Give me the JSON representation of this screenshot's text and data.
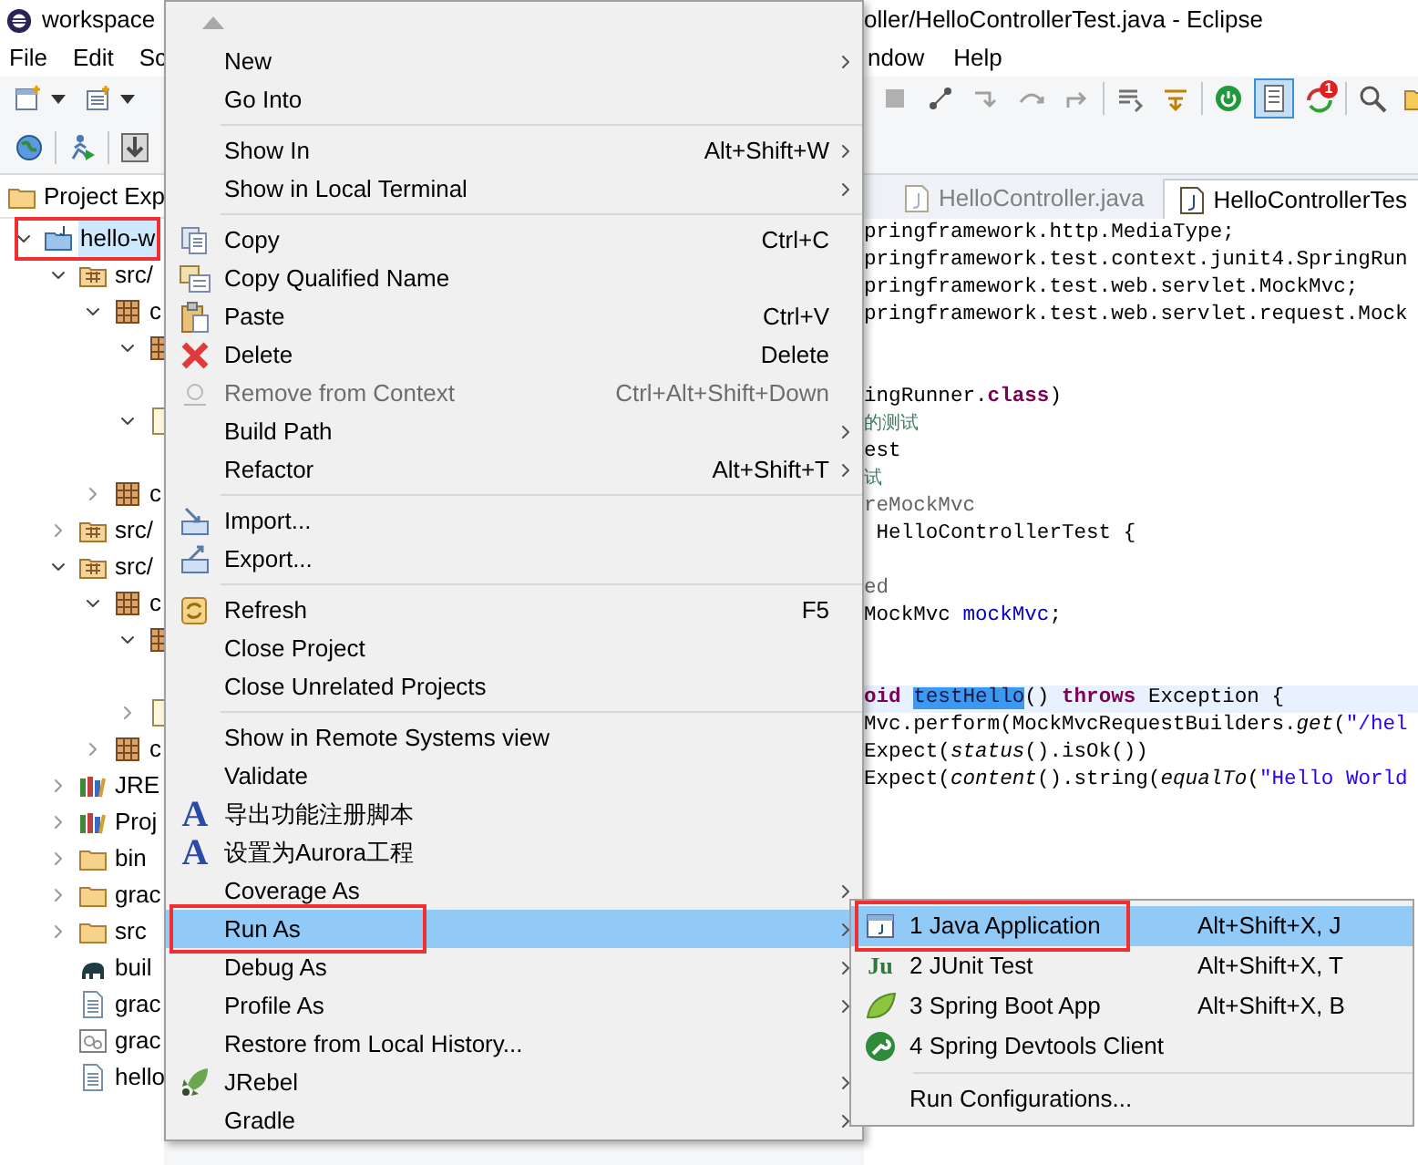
{
  "window": {
    "title_left": "workspace",
    "title_right": "oller/HelloControllerTest.java - Eclipse"
  },
  "menubar_left": [
    "File",
    "Edit",
    "Sc"
  ],
  "menubar_right": [
    "ndow",
    "Help"
  ],
  "toolbar_left": [
    {
      "kind": "new-window",
      "dropdown": true
    },
    {
      "kind": "new-file",
      "dropdown": true
    }
  ],
  "toolbar_right": [
    {
      "kind": "stop",
      "pressed": false
    },
    {
      "kind": "connect",
      "pressed": false
    },
    {
      "kind": "step-into",
      "pressed": false
    },
    {
      "kind": "step-over",
      "pressed": false
    },
    {
      "kind": "step-return",
      "pressed": false
    },
    {
      "kind": "separator"
    },
    {
      "kind": "filters",
      "pressed": false
    },
    {
      "kind": "drop-frame",
      "pressed": false
    },
    {
      "kind": "separator"
    },
    {
      "kind": "power",
      "pressed": false
    },
    {
      "kind": "toggle",
      "pressed": true
    },
    {
      "kind": "sync",
      "badge": "1",
      "pressed": false
    },
    {
      "kind": "separator"
    },
    {
      "kind": "search",
      "pressed": false
    },
    {
      "kind": "folder",
      "pressed": false
    }
  ],
  "toolbar_second": [
    {
      "kind": "globe"
    },
    {
      "kind": "separator"
    },
    {
      "kind": "run-person"
    },
    {
      "kind": "separator"
    },
    {
      "kind": "download"
    }
  ],
  "explorer": {
    "tab": "Project Exp",
    "tree": [
      {
        "label": "hello-w",
        "kind": "project",
        "expanded": true,
        "highlighted": true,
        "children": [
          {
            "label": "src/",
            "kind": "source-folder",
            "expanded": true,
            "children": [
              {
                "label": "c",
                "kind": "package",
                "expanded": true,
                "children": [
                  {
                    "kind": "package",
                    "expanded": true
                  },
                  {
                    "kind": "file",
                    "expanded": true
                  }
                ]
              },
              {
                "label": "c",
                "kind": "package",
                "expanded": false
              }
            ]
          },
          {
            "label": "src/",
            "kind": "source-folder",
            "expanded": false
          },
          {
            "label": "src/",
            "kind": "source-folder",
            "expanded": true,
            "children": [
              {
                "label": "c",
                "kind": "package",
                "expanded": true,
                "children": [
                  {
                    "kind": "package",
                    "expanded": true
                  },
                  {
                    "kind": "file",
                    "expanded": false
                  }
                ]
              },
              {
                "label": "c",
                "kind": "package",
                "expanded": false
              }
            ]
          },
          {
            "label": "JRE",
            "kind": "library",
            "expanded": false
          },
          {
            "label": "Proj",
            "kind": "library",
            "expanded": false
          },
          {
            "label": "bin",
            "kind": "folder",
            "expanded": false
          },
          {
            "label": "grac",
            "kind": "folder",
            "expanded": false
          },
          {
            "label": "src",
            "kind": "folder",
            "expanded": false
          },
          {
            "label": "buil",
            "kind": "gradle-file"
          },
          {
            "label": "grac",
            "kind": "text-file"
          },
          {
            "label": "grac",
            "kind": "settings-file"
          },
          {
            "label": "hello",
            "kind": "text-file"
          }
        ]
      }
    ]
  },
  "editor": {
    "tabs": [
      {
        "label": "HelloController.java",
        "selected": false
      },
      {
        "label": "HelloControllerTes",
        "selected": true
      }
    ],
    "code_lines": [
      {
        "kind": "code",
        "current": false,
        "tokens": [
          {
            "text": "pringframework.http.MediaType;",
            "kind": "plain"
          }
        ]
      },
      {
        "kind": "code",
        "current": false,
        "tokens": [
          {
            "text": "pringframework.test.context.junit4.SpringRun",
            "kind": "plain"
          }
        ]
      },
      {
        "kind": "code",
        "current": false,
        "tokens": [
          {
            "text": "pringframework.test.web.servlet.MockMvc;",
            "kind": "plain"
          }
        ]
      },
      {
        "kind": "code",
        "current": false,
        "tokens": [
          {
            "text": "pringframework.test.web.servlet.request.Mock",
            "kind": "plain"
          }
        ]
      },
      {
        "kind": "blank"
      },
      {
        "kind": "blank"
      },
      {
        "kind": "code",
        "current": false,
        "tokens": [
          {
            "text": "ingRunner.",
            "kind": "plain"
          },
          {
            "text": "class",
            "kind": "keyword"
          },
          {
            "text": ")",
            "kind": "plain"
          }
        ]
      },
      {
        "kind": "code",
        "current": false,
        "tokens": [
          {
            "text": "的测试",
            "kind": "comment"
          }
        ]
      },
      {
        "kind": "code",
        "current": false,
        "tokens": [
          {
            "text": "est",
            "kind": "plain"
          }
        ]
      },
      {
        "kind": "code",
        "current": false,
        "tokens": [
          {
            "text": "试",
            "kind": "comment"
          }
        ]
      },
      {
        "kind": "code",
        "current": false,
        "tokens": [
          {
            "text": "reMockMvc",
            "kind": "annotation"
          }
        ]
      },
      {
        "kind": "code",
        "current": false,
        "tokens": [
          {
            "text": " HelloControllerTest {",
            "kind": "plain"
          }
        ]
      },
      {
        "kind": "blank"
      },
      {
        "kind": "code",
        "current": false,
        "tokens": [
          {
            "text": "ed",
            "kind": "annotation"
          }
        ]
      },
      {
        "kind": "code",
        "current": false,
        "tokens": [
          {
            "text": "MockMvc ",
            "kind": "plain"
          },
          {
            "text": "mockMvc",
            "kind": "field"
          },
          {
            "text": ";",
            "kind": "plain"
          }
        ]
      },
      {
        "kind": "blank"
      },
      {
        "kind": "blank"
      },
      {
        "kind": "code",
        "current": true,
        "tokens": [
          {
            "text": "oid ",
            "kind": "keyword"
          },
          {
            "text": "testHello",
            "kind": "selected"
          },
          {
            "text": "() ",
            "kind": "plain"
          },
          {
            "text": "throws",
            "kind": "keyword"
          },
          {
            "text": " Exception {",
            "kind": "plain"
          }
        ]
      },
      {
        "kind": "code",
        "current": false,
        "tokens": [
          {
            "text": "Mvc.perform(MockMvcRequestBuilders.",
            "kind": "plain"
          },
          {
            "text": "get",
            "kind": "italic"
          },
          {
            "text": "(",
            "kind": "plain"
          },
          {
            "text": "\"/hel",
            "kind": "string"
          }
        ]
      },
      {
        "kind": "code",
        "current": false,
        "tokens": [
          {
            "text": "Expect(",
            "kind": "plain"
          },
          {
            "text": "status",
            "kind": "italic"
          },
          {
            "text": "().isOk())",
            "kind": "plain"
          }
        ]
      },
      {
        "kind": "code",
        "current": false,
        "tokens": [
          {
            "text": "Expect(",
            "kind": "plain"
          },
          {
            "text": "content",
            "kind": "italic"
          },
          {
            "text": "().string(",
            "kind": "plain"
          },
          {
            "text": "equalTo",
            "kind": "italic"
          },
          {
            "text": "(",
            "kind": "plain"
          },
          {
            "text": "\"Hello World",
            "kind": "string"
          }
        ]
      }
    ]
  },
  "context_menu": {
    "groups": [
      [
        {
          "label": "New",
          "kind": "plain",
          "submenu": true,
          "disabled": false,
          "selected": false,
          "highlighted": false
        },
        {
          "label": "Go Into",
          "kind": "plain",
          "submenu": false,
          "disabled": false,
          "selected": false,
          "highlighted": false
        }
      ],
      [
        {
          "label": "Show In",
          "kind": "plain",
          "shortcut": "Alt+Shift+W",
          "submenu": true,
          "disabled": false,
          "selected": false,
          "highlighted": false
        },
        {
          "label": "Show in Local Terminal",
          "kind": "plain",
          "submenu": true,
          "disabled": false,
          "selected": false,
          "highlighted": false
        }
      ],
      [
        {
          "label": "Copy",
          "shortcut": "Ctrl+C",
          "kind": "copy",
          "submenu": false,
          "disabled": false,
          "selected": false,
          "highlighted": false
        },
        {
          "label": "Copy Qualified Name",
          "kind": "copy-name",
          "submenu": false,
          "disabled": false,
          "selected": false,
          "highlighted": false
        },
        {
          "label": "Paste",
          "shortcut": "Ctrl+V",
          "kind": "paste",
          "submenu": false,
          "disabled": false,
          "selected": false,
          "highlighted": false
        },
        {
          "label": "Delete",
          "shortcut": "Delete",
          "kind": "delete",
          "submenu": false,
          "disabled": false,
          "selected": false,
          "highlighted": false
        },
        {
          "label": "Remove from Context",
          "shortcut": "Ctrl+Alt+Shift+Down",
          "kind": "remove",
          "submenu": false,
          "disabled": true,
          "selected": false,
          "highlighted": false
        },
        {
          "label": "Build Path",
          "kind": "plain",
          "submenu": true,
          "disabled": false,
          "selected": false,
          "highlighted": false
        },
        {
          "label": "Refactor",
          "kind": "plain",
          "shortcut": "Alt+Shift+T",
          "submenu": true,
          "disabled": false,
          "selected": false,
          "highlighted": false
        }
      ],
      [
        {
          "label": "Import...",
          "kind": "import",
          "submenu": false,
          "disabled": false,
          "selected": false,
          "highlighted": false
        },
        {
          "label": "Export...",
          "kind": "export",
          "submenu": false,
          "disabled": false,
          "selected": false,
          "highlighted": false
        }
      ],
      [
        {
          "label": "Refresh",
          "shortcut": "F5",
          "kind": "refresh",
          "submenu": false,
          "disabled": false,
          "selected": false,
          "highlighted": false
        },
        {
          "label": "Close Project",
          "kind": "plain",
          "submenu": false,
          "disabled": false,
          "selected": false,
          "highlighted": false
        },
        {
          "label": "Close Unrelated Projects",
          "kind": "plain",
          "submenu": false,
          "disabled": false,
          "selected": false,
          "highlighted": false
        }
      ],
      [
        {
          "label": "Show in Remote Systems view",
          "kind": "plain",
          "submenu": false,
          "disabled": false,
          "selected": false,
          "highlighted": false
        },
        {
          "label": "Validate",
          "kind": "plain",
          "submenu": false,
          "disabled": false,
          "selected": false,
          "highlighted": false
        },
        {
          "label": "导出功能注册脚本",
          "kind": "glyph",
          "glyph": "A",
          "submenu": false,
          "disabled": false,
          "selected": false,
          "highlighted": false
        },
        {
          "label": "设置为Aurora工程",
          "kind": "glyph",
          "glyph": "A",
          "submenu": false,
          "disabled": false,
          "selected": false,
          "highlighted": false
        },
        {
          "label": "Coverage As",
          "kind": "plain",
          "submenu": true,
          "disabled": false,
          "selected": false,
          "highlighted": false
        },
        {
          "label": "Run As",
          "kind": "plain",
          "submenu": true,
          "disabled": false,
          "selected": true,
          "highlighted": true
        },
        {
          "label": "Debug As",
          "kind": "plain",
          "submenu": true,
          "disabled": false,
          "selected": false,
          "highlighted": false
        },
        {
          "label": "Profile As",
          "kind": "plain",
          "submenu": true,
          "disabled": false,
          "selected": false,
          "highlighted": false
        },
        {
          "label": "Restore from Local History...",
          "kind": "plain",
          "submenu": false,
          "disabled": false,
          "selected": false,
          "highlighted": false
        },
        {
          "label": "JRebel",
          "kind": "jrebel",
          "submenu": true,
          "disabled": false,
          "selected": false,
          "highlighted": false
        },
        {
          "label": "Gradle",
          "kind": "plain",
          "submenu": true,
          "disabled": false,
          "selected": false,
          "highlighted": false
        }
      ]
    ]
  },
  "run_as_menu": {
    "groups": [
      [
        {
          "label": "1 Java Application",
          "shortcut": "Alt+Shift+X, J",
          "kind": "java-app",
          "selected": true,
          "highlighted": true
        },
        {
          "label": "2 JUnit Test",
          "shortcut": "Alt+Shift+X, T",
          "kind": "glyph",
          "glyph": "Ju",
          "selected": false,
          "highlighted": false
        },
        {
          "label": "3 Spring Boot App",
          "shortcut": "Alt+Shift+X, B",
          "kind": "spring",
          "selected": false,
          "highlighted": false
        },
        {
          "label": "4 Spring Devtools Client",
          "kind": "devtools",
          "selected": false,
          "highlighted": false
        }
      ],
      [
        {
          "label": "Run Configurations...",
          "kind": "plain",
          "selected": false,
          "highlighted": false
        }
      ]
    ]
  }
}
